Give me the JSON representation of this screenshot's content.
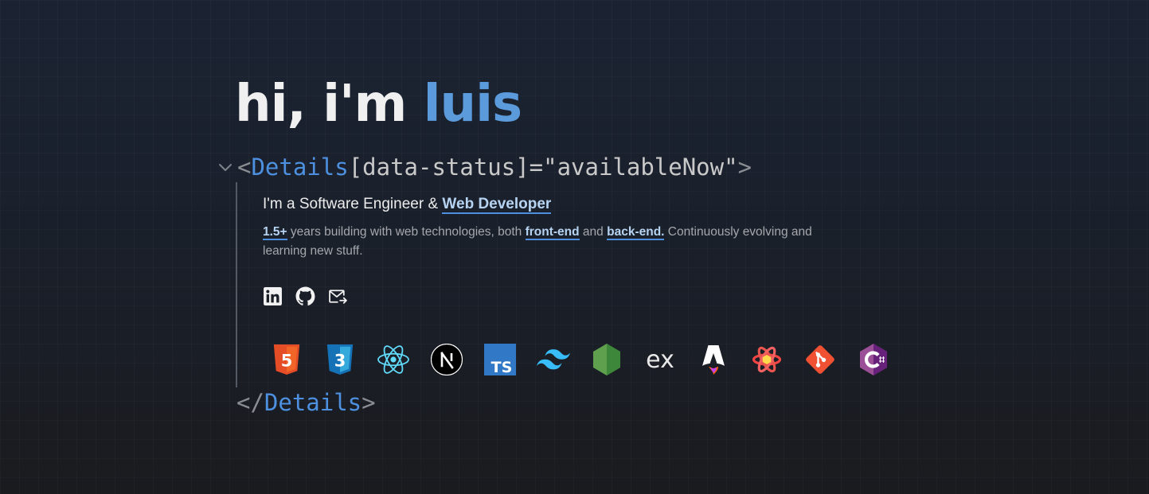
{
  "hero": {
    "prefix": "hi, i'm ",
    "name": "luis"
  },
  "tag": {
    "open_bracket": "<",
    "name": "Details",
    "attribute": " [data-status]=\"availableNow\"",
    "close_bracket": ">",
    "closing_open": "</",
    "closing_name": "Details",
    "closing_close": ">"
  },
  "intro": {
    "headline_prefix": "I'm a Software Engineer & ",
    "headline_link": "Web Developer",
    "years": "1.5+",
    "text_1": " years building with web technologies, both ",
    "front_end": "front-end",
    "text_2": " and ",
    "back_end": "back-end.",
    "text_3": " Continuously evolving and learning new stuff."
  },
  "social": [
    {
      "icon": "linkedin-icon"
    },
    {
      "icon": "github-icon"
    },
    {
      "icon": "email-icon"
    }
  ],
  "tech_stack": {
    "html5": "5",
    "css3": "3",
    "typescript": "TS",
    "express": "ex",
    "icons": [
      "html5-icon",
      "css3-icon",
      "react-icon",
      "nextjs-icon",
      "typescript-icon",
      "tailwind-icon",
      "nodejs-icon",
      "express-icon",
      "astro-icon",
      "react-query-icon",
      "git-icon",
      "csharp-icon"
    ]
  },
  "colors": {
    "accent": "#4d90e0",
    "name": "#5b9bdc",
    "link_text": "#b6d3f2"
  }
}
